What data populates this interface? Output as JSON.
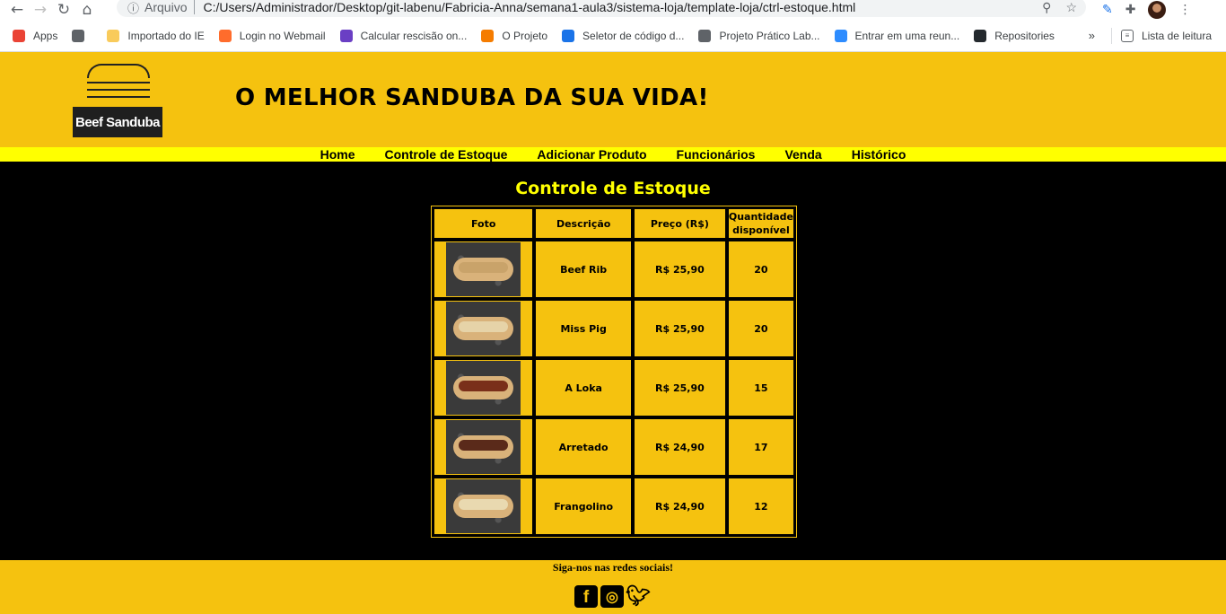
{
  "browser": {
    "scheme": "Arquivo",
    "url": "C:/Users/Administrador/Desktop/git-labenu/Fabricia-Anna/semana1-aula3/sistema-loja/template-loja/ctrl-estoque.html",
    "bookmarks": [
      {
        "label": "Apps",
        "icon": "apps-grid-icon",
        "color": "#ea4335"
      },
      {
        "label": "",
        "icon": "g-icon",
        "color": "#5f6368"
      },
      {
        "label": "Importado do IE",
        "icon": "folder-icon",
        "color": "#f9cb5b"
      },
      {
        "label": "Login no Webmail",
        "icon": "cpanel-icon",
        "color": "#ff6c2c"
      },
      {
        "label": "Calcular rescisão on...",
        "icon": "cr-icon",
        "color": "#6a3fc4"
      },
      {
        "label": "O Projeto",
        "icon": "flame-icon",
        "color": "#f57c00"
      },
      {
        "label": "Seletor de código d...",
        "icon": "globe-icon",
        "color": "#1a73e8"
      },
      {
        "label": "Projeto Prático Lab...",
        "icon": "globe-dark-icon",
        "color": "#5f6368"
      },
      {
        "label": "Entrar em uma reun...",
        "icon": "zoom-icon",
        "color": "#2d8cff"
      },
      {
        "label": "Repositories",
        "icon": "github-icon",
        "color": "#24292e"
      }
    ],
    "more_label": "»",
    "reading_list": "Lista de leitura"
  },
  "header": {
    "logo_text": "Beef Sanduba",
    "tagline": "O MELHOR SANDUBA DA SUA VIDA!"
  },
  "menu": [
    "Home",
    "Controle de Estoque",
    "Adicionar Produto",
    "Funcionários",
    "Venda",
    "Histórico"
  ],
  "page": {
    "title": "Controle de Estoque",
    "columns": [
      "Foto",
      "Descrição",
      "Preço (R$)",
      "Quantidade disponível"
    ],
    "rows": [
      {
        "name": "Beef Rib",
        "price": "R$ 25,90",
        "qty": "20",
        "fill": "#c9a36a"
      },
      {
        "name": "Miss Pig",
        "price": "R$ 25,90",
        "qty": "20",
        "fill": "#e6d3a8"
      },
      {
        "name": "A Loka",
        "price": "R$ 25,90",
        "qty": "15",
        "fill": "#7a2f1a"
      },
      {
        "name": "Arretado",
        "price": "R$ 24,90",
        "qty": "17",
        "fill": "#5a2a1a"
      },
      {
        "name": "Frangolino",
        "price": "R$ 24,90",
        "qty": "12",
        "fill": "#e9d9b0"
      }
    ]
  },
  "footer": {
    "text": "Siga-nos nas redes sociais!",
    "social": [
      "facebook-icon",
      "instagram-icon",
      "twitter-icon"
    ]
  }
}
